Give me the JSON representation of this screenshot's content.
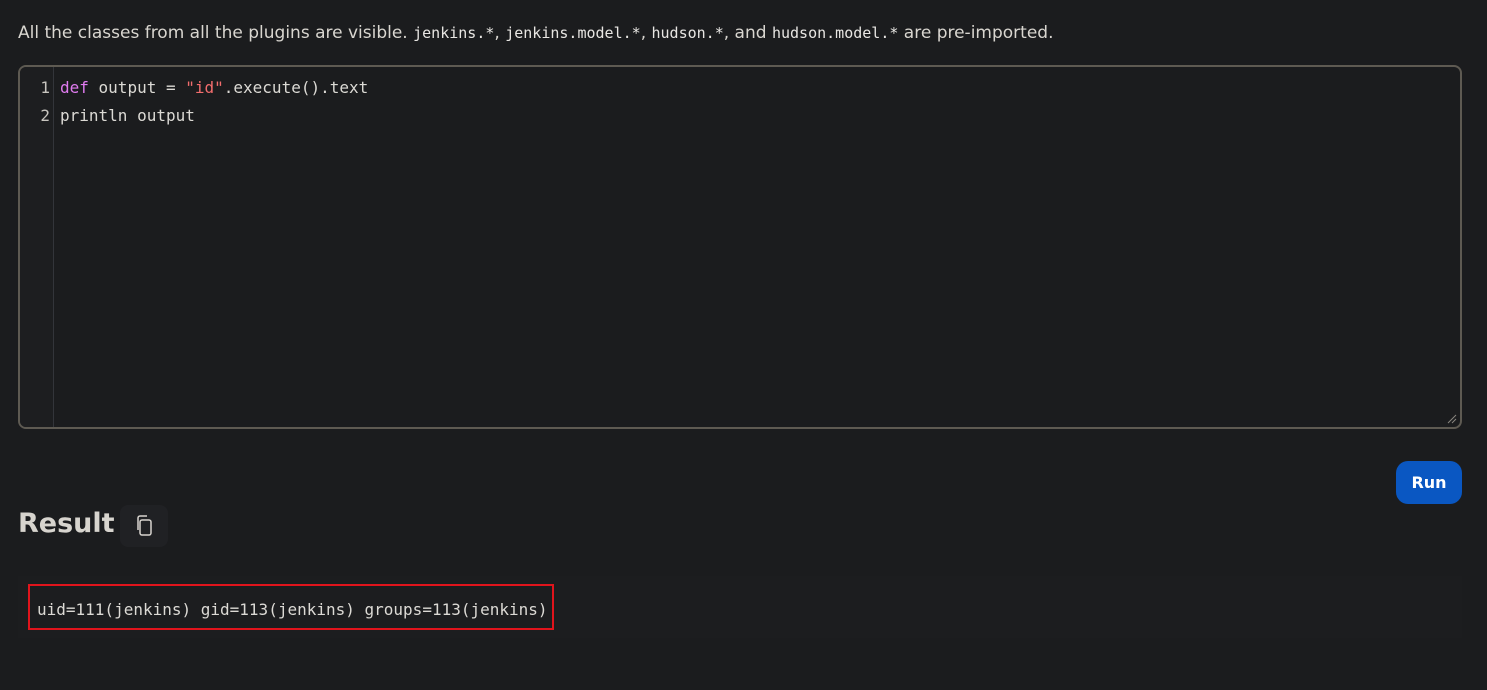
{
  "intro": {
    "prefix": "All the classes from all the plugins are visible. ",
    "pkg1": "jenkins.*",
    "sep1": ", ",
    "pkg2": "jenkins.model.*",
    "sep2": ", ",
    "pkg3": "hudson.*",
    "sep3": ", and ",
    "pkg4": "hudson.model.*",
    "suffix": " are pre-imported."
  },
  "editor": {
    "lines": [
      {
        "number": "1",
        "keyword": "def",
        "text1": " output = ",
        "string": "\"id\"",
        "text2": ".execute().text"
      },
      {
        "number": "2",
        "text": "println output"
      }
    ]
  },
  "run_button": {
    "label": "Run"
  },
  "result": {
    "title": "Result",
    "copy_icon": "copy-icon",
    "output": "uid=111(jenkins) gid=113(jenkins) groups=113(jenkins)"
  },
  "colors": {
    "background": "#1b1c1e",
    "run_button": "#0a57c2",
    "keyword": "#e07bf0",
    "string": "#f26d6d",
    "highlight_border": "#e0141c"
  }
}
